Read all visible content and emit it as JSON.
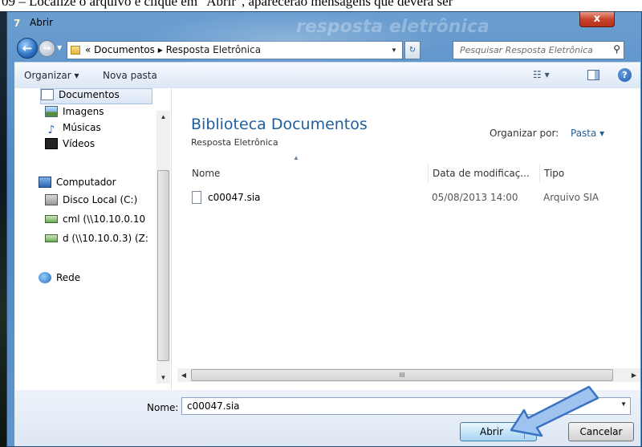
{
  "document": {
    "text": "09 – Localize o arquivo e clique em \"Abrir\", aparecerão mensagens que deverá ser"
  },
  "window": {
    "title": "Abrir",
    "close_label": "x",
    "watermark": "resposta eletrônica"
  },
  "navigation": {
    "back_icon": "back-arrow-icon",
    "forward_icon": "forward-arrow-icon",
    "breadcrumb_prefix": "«",
    "breadcrumb": [
      "Documentos",
      "Resposta Eletrônica"
    ],
    "breadcrumb_sep": "▸",
    "search_placeholder": "Pesquisar Resposta Eletrônica"
  },
  "toolbar": {
    "organize_label": "Organizar ▾",
    "new_folder_label": "Nova pasta"
  },
  "sidebar": {
    "items": [
      {
        "label": "Documentos",
        "icon": "document-icon",
        "selected": true
      },
      {
        "label": "Imagens",
        "icon": "images-icon"
      },
      {
        "label": "Músicas",
        "icon": "music-icon"
      },
      {
        "label": "Vídeos",
        "icon": "video-icon"
      },
      {
        "label": "Computador",
        "icon": "computer-icon"
      },
      {
        "label": "Disco Local (C:)",
        "icon": "disk-icon"
      },
      {
        "label": "cml (\\\\10.10.0.10",
        "icon": "network-drive-icon"
      },
      {
        "label": "d (\\\\10.10.0.3) (Z:",
        "icon": "network-drive-icon"
      },
      {
        "label": "Rede",
        "icon": "network-icon"
      }
    ]
  },
  "library": {
    "title": "Biblioteca Documentos",
    "subtitle": "Resposta Eletrônica",
    "arrange_label": "Organizar por:",
    "arrange_value": "Pasta ▾"
  },
  "columns": {
    "name": "Nome",
    "date": "Data de modificaç...",
    "type": "Tipo"
  },
  "files": [
    {
      "name": "c00047.sia",
      "date": "05/08/2013 14:00",
      "type": "Arquivo SIA"
    }
  ],
  "hscroll": {
    "grip": "III"
  },
  "footer": {
    "name_label": "Nome:",
    "name_value": "c00047.sia",
    "open_label": "Abrir",
    "cancel_label": "Cancelar"
  }
}
